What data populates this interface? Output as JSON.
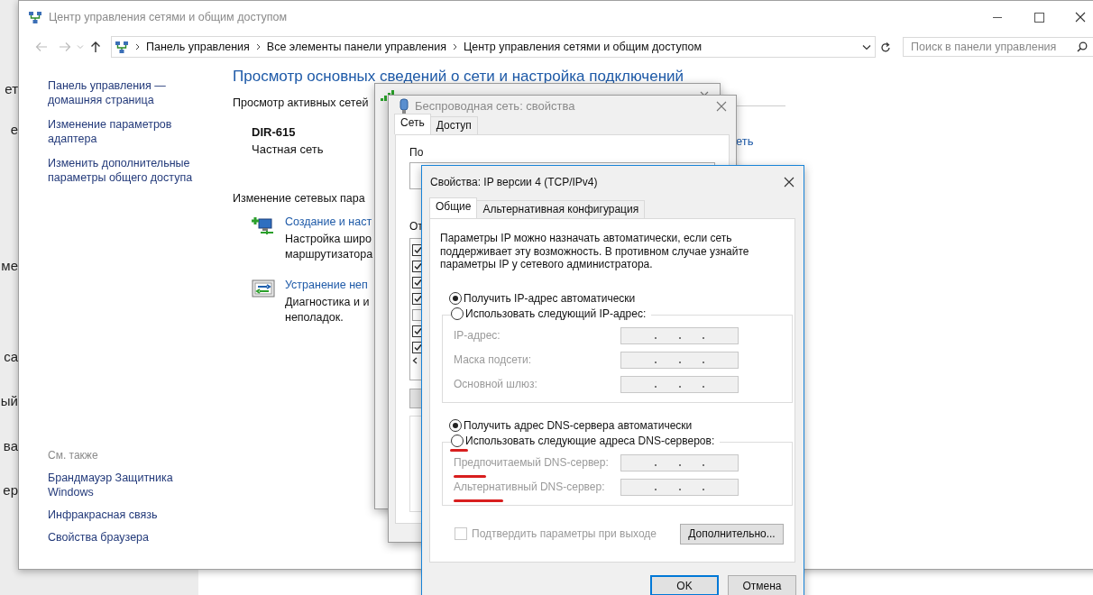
{
  "background_window": {
    "fragments": [
      "ет",
      "е",
      "ме",
      "са",
      "ый",
      "ва",
      "ер"
    ]
  },
  "window": {
    "title": "Центр управления сетями и общим доступом",
    "breadcrumb": [
      "Панель управления",
      "Все элементы панели управления",
      "Центр управления сетями и общим доступом"
    ],
    "search": {
      "placeholder": "Поиск в панели управления"
    }
  },
  "sidebar": {
    "links": [
      "Панель управления — домашняя страница",
      "Изменение параметров адаптера",
      "Изменить дополнительные параметры общего доступа"
    ],
    "see_also": {
      "heading": "См. также",
      "links": [
        "Брандмауэр Защитника Windows",
        "Инфракрасная связь",
        "Свойства браузера"
      ]
    }
  },
  "content": {
    "heading": "Просмотр основных сведений о сети и настройка подключений",
    "active_networks_label": "Просмотр активных сетей",
    "network": {
      "name": "DIR-615",
      "type": "Частная сеть",
      "link": "еть"
    },
    "settings_label": "Изменение сетевых пара",
    "tasks": [
      {
        "kind": "setup",
        "title": "Создание и наст",
        "description": [
          "Настройка широ",
          "маршрутизатора"
        ]
      },
      {
        "kind": "troubleshoot",
        "title": "Устранение неп",
        "description": [
          "Диагностика и и",
          "неполадок."
        ]
      }
    ]
  },
  "wireless_dialog": {
    "title": "Беспроводная сеть: свойства",
    "tabs": [
      {
        "label": "Сеть",
        "selected": true
      },
      {
        "label": "Доступ",
        "selected": false
      }
    ],
    "labels": [
      "По",
      "От"
    ],
    "components": [
      {
        "checked": true
      },
      {
        "checked": true
      },
      {
        "checked": true
      },
      {
        "checked": true
      },
      {
        "checked": false
      },
      {
        "checked": true
      },
      {
        "checked": true
      }
    ]
  },
  "ipv4_dialog": {
    "title": "Свойства: IP версии 4 (TCP/IPv4)",
    "tabs": [
      {
        "label": "Общие",
        "selected": true
      },
      {
        "label": "Альтернативная конфигурация",
        "selected": false
      }
    ],
    "description": "Параметры IP можно назначать автоматически, если сеть поддерживает эту возможность. В противном случае узнайте параметры IP у сетевого администратора.",
    "ip_options": [
      {
        "label": "Получить IP-адрес автоматически",
        "selected": true,
        "annotated": false
      },
      {
        "label": "Использовать следующий IP-адрес:",
        "selected": false,
        "annotated": false
      }
    ],
    "ip_fields": [
      {
        "label": "IP-адрес:",
        "disabled": true,
        "annotated": false
      },
      {
        "label": "Маска подсети:",
        "disabled": true,
        "annotated": false
      },
      {
        "label": "Основной шлюз:",
        "disabled": true,
        "annotated": false
      }
    ],
    "dns_options": [
      {
        "label": "Получить адрес DNS-сервера автоматически",
        "selected": true,
        "annotated": false
      },
      {
        "label": "Использовать следующие адреса DNS-серверов:",
        "selected": false,
        "annotated": true
      }
    ],
    "dns_fields": [
      {
        "label": "Предпочитаемый DNS-сервер:",
        "disabled": true,
        "annotated": true
      },
      {
        "label": "Альтернативный DNS-сервер:",
        "disabled": true,
        "annotated": true
      }
    ],
    "confirm": {
      "label": "Подтвердить параметры при выходе",
      "checked": false,
      "disabled": true
    },
    "advanced_button": "Дополнительно...",
    "buttons": [
      {
        "label": "OK",
        "default": true
      },
      {
        "label": "Отмена",
        "default": false
      }
    ]
  }
}
